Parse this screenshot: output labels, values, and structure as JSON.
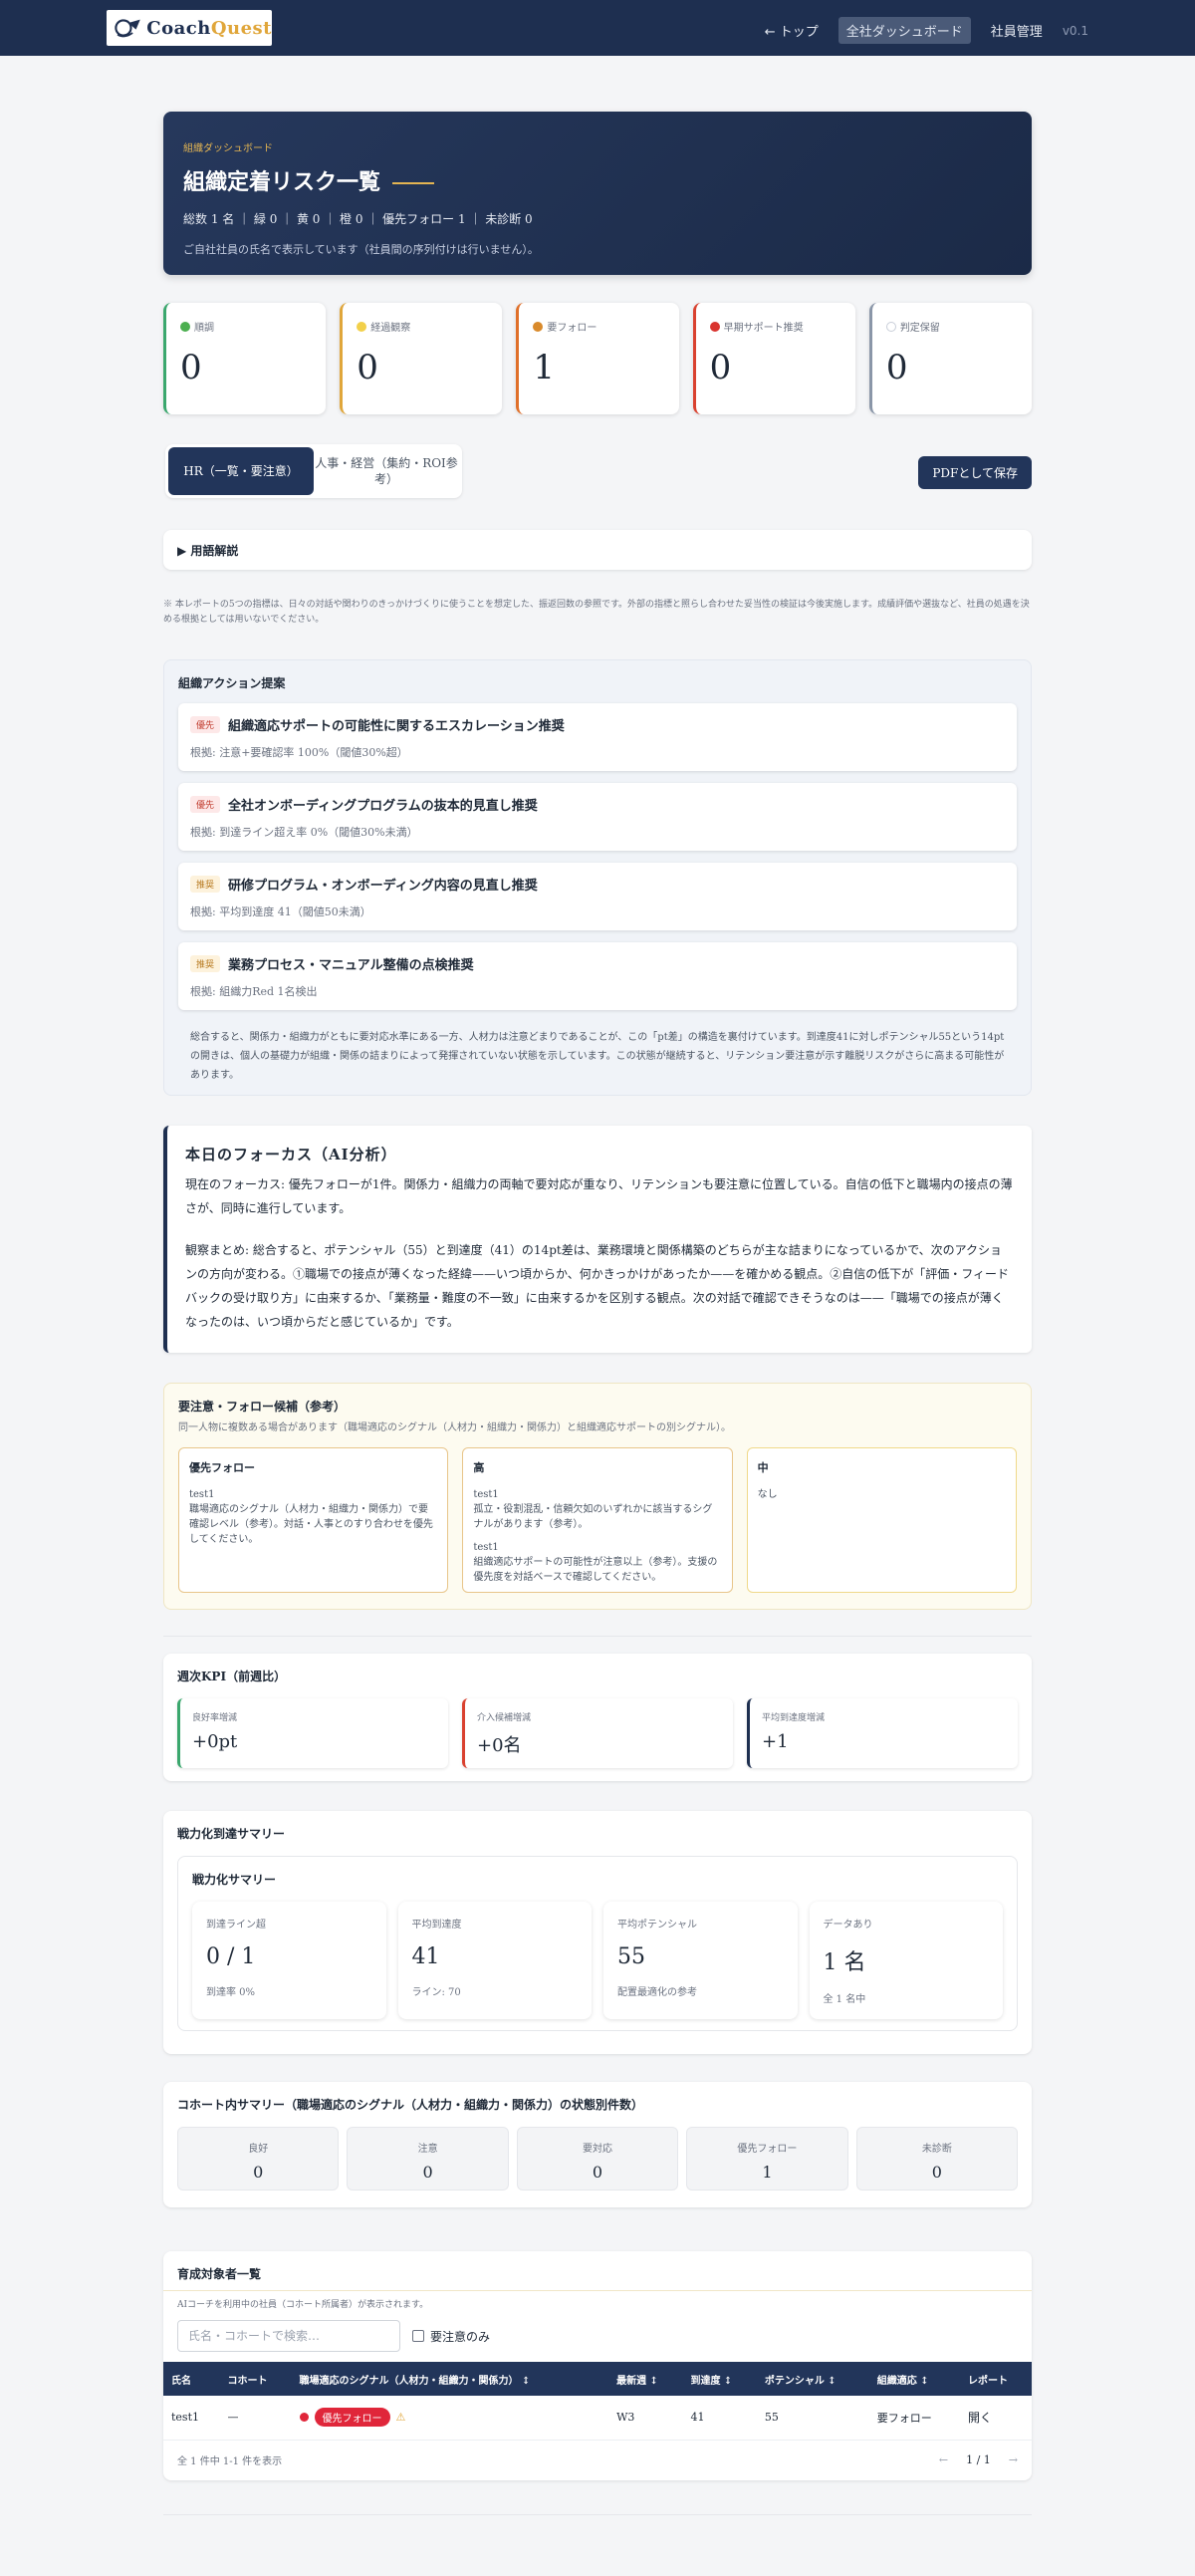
{
  "nav": {
    "brand_a": "Coach",
    "brand_b": "Quest",
    "top": "← トップ",
    "dashboard": "全社ダッシュボード",
    "employees": "社員管理",
    "version": "v0.1"
  },
  "hero": {
    "kicker": "組織ダッシュボード",
    "title": "組織定着リスク一覧",
    "stats": "総数 1 名 ｜ 緑 0 ｜ 黄 0 ｜ 橙 0 ｜ 優先フォロー 1 ｜ 未診断 0",
    "note": "ご自社社員の氏名で表示しています（社員間の序列付けは行いません）。"
  },
  "status_cards": [
    {
      "label": "順調",
      "value": "0",
      "color": "#3aa76d",
      "dot": "#4caf50"
    },
    {
      "label": "経過観察",
      "value": "0",
      "color": "#e0a63a",
      "dot": "#f2d04a"
    },
    {
      "label": "要フォロー",
      "value": "1",
      "color": "#e0702a",
      "dot": "#d98a2b"
    },
    {
      "label": "早期サポート推奨",
      "value": "0",
      "color": "#d9412f",
      "dot": "#d9342f"
    },
    {
      "label": "判定保留",
      "value": "0",
      "color": "#8a96a8",
      "dot": "#ffffff"
    }
  ],
  "tabs": {
    "hr": "HR（一覧・要注意）",
    "exec": "人事・経営（集約・ROI参考）",
    "pdf": "PDFとして保存"
  },
  "glossary": "▶ 用語解説",
  "disclaimer": "※ 本レポートの5つの指標は、日々の対話や関わりのきっかけづくりに使うことを想定した、振返回数の参照です。外部の指標と照らし合わせた妥当性の検証は今後実施します。成績評価や選抜など、社員の処遇を決める根拠としては用いないでください。",
  "actions": {
    "title": "組織アクション提案",
    "items": [
      {
        "badge": "優先",
        "title": "組織適応サポートの可能性に関するエスカレーション推奨",
        "basis": "根拠: 注意+要確認率 100%（閾値30%超）"
      },
      {
        "badge": "優先",
        "title": "全社オンボーディングプログラムの抜本的見直し推奨",
        "basis": "根拠: 到達ライン超え率 0%（閾値30%未満）"
      },
      {
        "badge": "推奨",
        "title": "研修プログラム・オンボーディング内容の見直し推奨",
        "basis": "根拠: 平均到達度 41（閾値50未満）"
      },
      {
        "badge": "推奨",
        "title": "業務プロセス・マニュアル整備の点検推奨",
        "basis": "根拠: 組織力Red 1名検出"
      }
    ],
    "summary": "総合すると、関係力・組織力がともに要対応水準にある一方、人材力は注意どまりであることが、この「pt差」の構造を裏付けています。到達度41に対しポテンシャル55という14ptの開きは、個人の基礎力が組織・関係の詰まりによって発揮されていない状態を示しています。この状態が継続すると、リテンション要注意が示す離脱リスクがさらに高まる可能性があります。"
  },
  "focus": {
    "title": "本日のフォーカス（AI分析）",
    "p1": "現在のフォーカス: 優先フォローが1件。関係力・組織力の両軸で要対応が重なり、リテンションも要注意に位置している。自信の低下と職場内の接点の薄さが、同時に進行しています。",
    "p2": "観察まとめ: 総合すると、ポテンシャル（55）と到達度（41）の14pt差は、業務環境と関係構築のどちらが主な詰まりになっているかで、次のアクションの方向が変わる。①職場での接点が薄くなった経緯——いつ頃からか、何かきっかけがあったか——を確かめる観点。②自信の低下が「評価・フィードバックの受け取り方」に由来するか、「業務量・難度の不一致」に由来するかを区別する観点。次の対話で確認できそうなのは——「職場での接点が薄くなったのは、いつ頃からだと感じているか」です。"
  },
  "candidates": {
    "title": "要注意・フォロー候補（参考）",
    "sub": "同一人物に複数ある場合があります（職場適応のシグナル（人材力・組織力・関係力）と組織適応サポートの別シグナル）。",
    "priority": {
      "head": "優先フォロー",
      "name": "test1",
      "text": "職場適応のシグナル（人材力・組織力・関係力）で要確認レベル（参考）。対話・人事とのすり合わせを優先してください。"
    },
    "high": {
      "head": "高",
      "entries": [
        {
          "name": "test1",
          "text": "孤立・役割混乱・信頼欠如のいずれかに該当するシグナルがあります（参考）。"
        },
        {
          "name": "test1",
          "text": "組織適応サポートの可能性が注意以上（参考）。支援の優先度を対話ベースで確認してください。"
        }
      ]
    },
    "mid": {
      "head": "中",
      "text": "なし"
    }
  },
  "kpi": {
    "title": "週次KPI（前週比）",
    "items": [
      {
        "label": "良好率増減",
        "value": "+0pt",
        "color": "#3aa76d"
      },
      {
        "label": "介入候補増減",
        "value": "+0名",
        "color": "#d9412f"
      },
      {
        "label": "平均到達度増減",
        "value": "+1",
        "color": "#1e2f50"
      }
    ]
  },
  "strength": {
    "title": "戦力化到達サマリー",
    "inner_title": "戦力化サマリー",
    "items": [
      {
        "label": "到達ライン超",
        "value": "0 / 1",
        "note": "到達率 0%"
      },
      {
        "label": "平均到達度",
        "value": "41",
        "note": "ライン: 70"
      },
      {
        "label": "平均ポテンシャル",
        "value": "55",
        "note": "配置最適化の参考"
      },
      {
        "label": "データあり",
        "value": "1 名",
        "note": "全 1 名中"
      }
    ]
  },
  "cohort": {
    "title": "コホート内サマリー（職場適応のシグナル（人材力・組織力・関係力）の状態別件数）",
    "items": [
      {
        "label": "良好",
        "value": "0"
      },
      {
        "label": "注意",
        "value": "0"
      },
      {
        "label": "要対応",
        "value": "0"
      },
      {
        "label": "優先フォロー",
        "value": "1"
      },
      {
        "label": "未診断",
        "value": "0"
      }
    ]
  },
  "trainees": {
    "title": "育成対象者一覧",
    "sub": "AIコーチを利用中の社員（コホート所属者）が表示されます。",
    "search_placeholder": "氏名・コホートで検索…",
    "filter_label": "要注意のみ",
    "columns": [
      "氏名",
      "コホート",
      "職場適応のシグナル（人材力・組織力・関係力） ↕",
      "最新週 ↕",
      "到達度 ↕",
      "ポテンシャル ↕",
      "組織適応 ↕",
      "レポート"
    ],
    "rows": [
      {
        "name": "test1",
        "cohort": "—",
        "signal": "優先フォロー",
        "warn": "⚠",
        "week": "W3",
        "reach": "41",
        "potential": "55",
        "org": "要フォロー",
        "report": "開く"
      }
    ],
    "footer": "全 1 件中 1-1 件を表示",
    "page": "1 / 1",
    "prev": "←",
    "next": "→"
  }
}
